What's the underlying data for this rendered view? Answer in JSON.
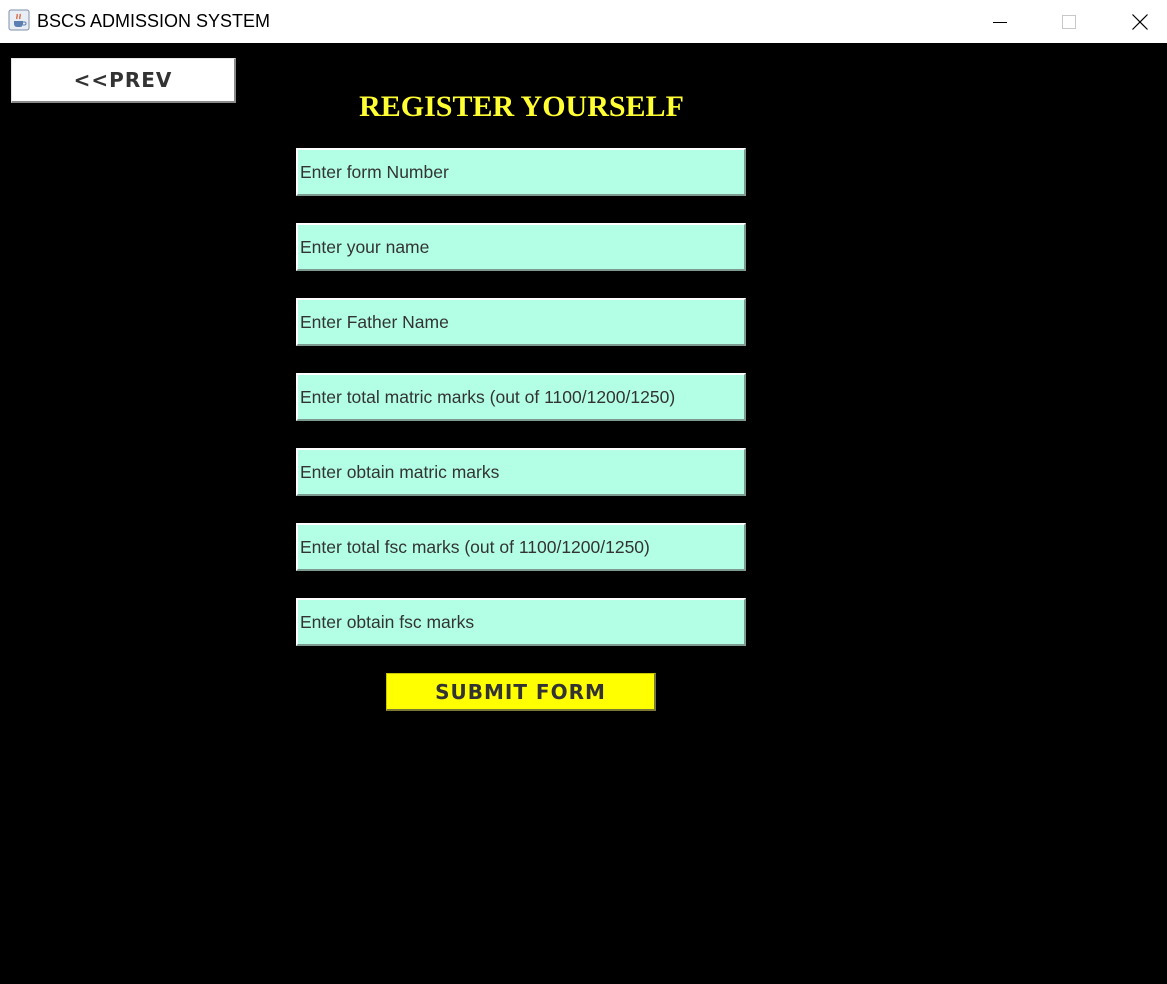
{
  "window": {
    "title": "BSCS ADMISSION SYSTEM",
    "app_icon": "java-cup-icon",
    "controls": [
      "minimize-icon",
      "maximize-icon",
      "close-icon"
    ]
  },
  "nav": {
    "prev_label": "<<PREV"
  },
  "form": {
    "title": "REGISTER YOURSELF",
    "fields": [
      {
        "value": "Enter form Number"
      },
      {
        "value": "Enter your name"
      },
      {
        "value": "Enter Father Name"
      },
      {
        "value": "Enter total matric marks (out of 1100/1200/1250)"
      },
      {
        "value": "Enter obtain matric marks"
      },
      {
        "value": "Enter total fsc marks (out of 1100/1200/1250)"
      },
      {
        "value": "Enter obtain fsc marks"
      }
    ],
    "submit_label": "SUBMIT FORM"
  },
  "colors": {
    "background": "#000000",
    "title": "#ffff33",
    "field_background": "#b3ffe6",
    "submit_background": "#ffff00",
    "button_text": "#333333"
  }
}
